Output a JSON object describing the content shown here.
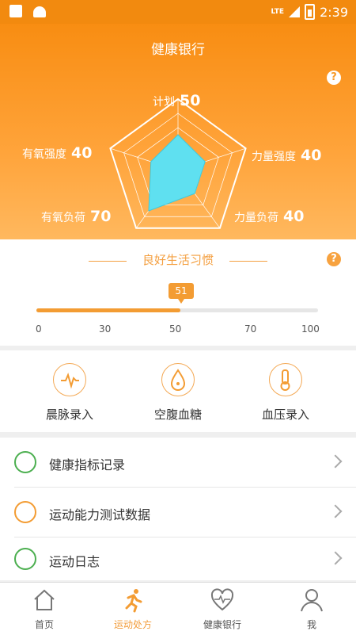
{
  "status": {
    "lte": "LTE",
    "time": "2:39"
  },
  "hero": {
    "title": "健康银行",
    "radar": [
      {
        "label": "计划",
        "value": "50"
      },
      {
        "label": "力量强度",
        "value": "40"
      },
      {
        "label": "力量负荷",
        "value": "40"
      },
      {
        "label": "有氧负荷",
        "value": "70"
      },
      {
        "label": "有氧强度",
        "value": "40"
      }
    ]
  },
  "habit": {
    "title": "良好生活习惯",
    "value": "51",
    "progress_fraction": 0.51,
    "ticks": [
      "0",
      "30",
      "50",
      "70",
      "100"
    ]
  },
  "quick_actions": [
    {
      "label": "晨脉录入",
      "icon": "pulse-icon"
    },
    {
      "label": "空腹血糖",
      "icon": "glucose-drop-icon"
    },
    {
      "label": "血压录入",
      "icon": "thermometer-icon"
    }
  ],
  "list": [
    {
      "label": "健康指标记录",
      "icon": "alarm-clock-icon",
      "color": "#4caf50"
    },
    {
      "label": "运动能力测试数据",
      "icon": "runner-icon",
      "color": "#f39c33"
    },
    {
      "label": "运动日志",
      "icon": "notebook-icon",
      "color": "#4caf50"
    }
  ],
  "tabs": [
    {
      "label": "首页",
      "icon": "home-icon"
    },
    {
      "label": "运动处方",
      "icon": "runner-icon"
    },
    {
      "label": "健康银行",
      "icon": "heart-pulse-icon"
    },
    {
      "label": "我",
      "icon": "person-icon"
    }
  ],
  "colors": {
    "orange": "#f88d12",
    "accent": "#f39c33",
    "radar_fill": "#5fe0f0"
  }
}
